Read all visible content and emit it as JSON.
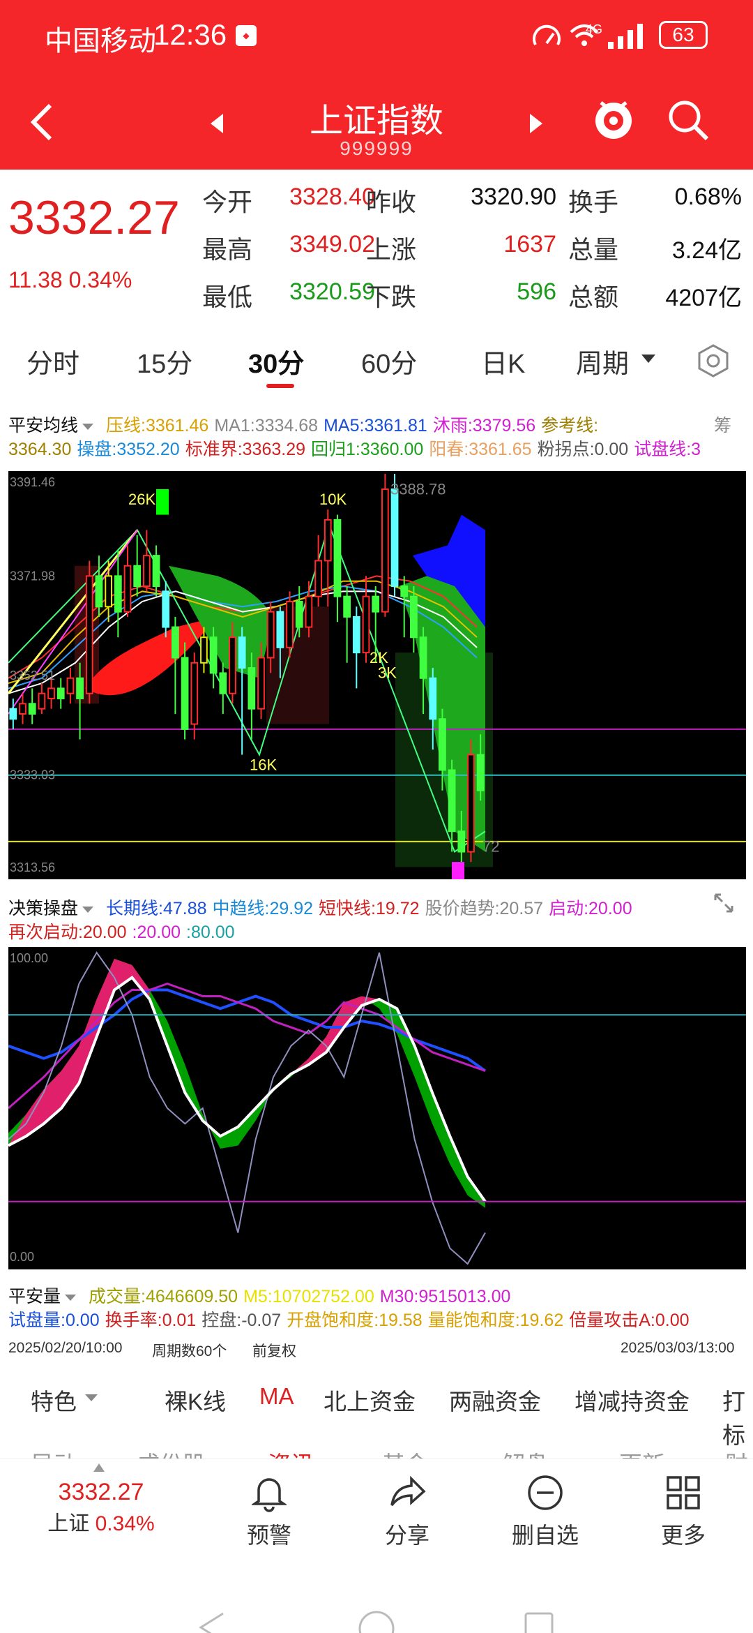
{
  "status": {
    "carrier": "中国移动",
    "time": "12:36",
    "network": "4G",
    "battery": "63"
  },
  "header": {
    "title": "上证指数",
    "code": "999999"
  },
  "quote": {
    "price": "3332.27",
    "change": "11.38",
    "pct": "0.34%",
    "rows": [
      [
        {
          "l": "今开",
          "v": "3328.40",
          "c": "#e02020"
        },
        {
          "l": "昨收",
          "v": "3320.90",
          "c": "#111"
        },
        {
          "l": "换手",
          "v": "0.68%",
          "c": "#111"
        }
      ],
      [
        {
          "l": "最高",
          "v": "3349.02",
          "c": "#e02020"
        },
        {
          "l": "上涨",
          "v": "1637",
          "c": "#e02020"
        },
        {
          "l": "总量",
          "v": "3.24亿",
          "c": "#111"
        }
      ],
      [
        {
          "l": "最低",
          "v": "3320.59",
          "c": "#1a9a1a"
        },
        {
          "l": "下跌",
          "v": "596",
          "c": "#1a9a1a"
        },
        {
          "l": "总额",
          "v": "4207亿",
          "c": "#111"
        }
      ]
    ]
  },
  "tabs": [
    "分时",
    "15分",
    "30分",
    "60分",
    "日K",
    "周期"
  ],
  "ind1": {
    "name": "平安均线",
    "line1": [
      {
        "t": "压线:",
        "v": "3361.46",
        "c": "#d8a000"
      },
      {
        "t": "MA1:",
        "v": "3334.68",
        "c": "#888"
      },
      {
        "t": "MA5:",
        "v": "3361.81",
        "c": "#1a4fd8"
      },
      {
        "t": "沐雨:",
        "v": "3379.56",
        "c": "#d020d0"
      },
      {
        "t": "参考线:",
        "v": "",
        "c": "#a08000"
      }
    ],
    "tail1": "筹",
    "line2": [
      {
        "t": "",
        "v": "3364.30",
        "c": "#a08000"
      },
      {
        "t": "操盘:",
        "v": "3352.20",
        "c": "#1a8ad8"
      },
      {
        "t": "标准界:",
        "v": "3363.29",
        "c": "#d02020"
      },
      {
        "t": "回归1:",
        "v": "3360.00",
        "c": "#1aa01a"
      },
      {
        "t": "阳春:",
        "v": "3361.65",
        "c": "#e8a060"
      },
      {
        "t": "粉拐点:",
        "v": "0.00",
        "c": "#555"
      },
      {
        "t": "试盘线:",
        "v": "3",
        "c": "#d020d0"
      }
    ]
  },
  "chart1": {
    "ticks": [
      "3391.46",
      "3371.98",
      "3352.51",
      "3333.03",
      "3313.56"
    ],
    "labels": [
      "26K",
      "10K",
      "3388.78",
      "2K",
      "3K",
      "16K",
      "72"
    ]
  },
  "ind2": {
    "name": "决策操盘",
    "line1": [
      {
        "t": "长期线:",
        "v": "47.88",
        "c": "#1a4fd8"
      },
      {
        "t": "中趋线:",
        "v": "29.92",
        "c": "#1a8ad8"
      },
      {
        "t": "短快线:",
        "v": "19.72",
        "c": "#d02020"
      },
      {
        "t": "股价趋势:",
        "v": "20.57",
        "c": "#888"
      },
      {
        "t": "启动:",
        "v": "20.00",
        "c": "#d020d0"
      }
    ],
    "line2": [
      {
        "t": "再次启动:",
        "v": "20.00",
        "c": "#d02020"
      },
      {
        "t": ":",
        "v": "20.00",
        "c": "#d020d0"
      },
      {
        "t": ":",
        "v": "80.00",
        "c": "#1aa0a0"
      }
    ]
  },
  "chart2": {
    "ticks": [
      "100.00",
      "0.00"
    ]
  },
  "ind3": {
    "name": "平安量",
    "line1": [
      {
        "t": "成交量:",
        "v": "4646609.50",
        "c": "#a0a000"
      },
      {
        "t": "M5:",
        "v": "10702752.00",
        "c": "#e8e000"
      },
      {
        "t": "M30:",
        "v": "9515013.00",
        "c": "#d020d0"
      }
    ],
    "line2": [
      {
        "t": "试盘量:",
        "v": "0.00",
        "c": "#1a4fd8"
      },
      {
        "t": "换手率:",
        "v": "0.01",
        "c": "#d02020"
      },
      {
        "t": "控盘:",
        "v": "-0.07",
        "c": "#555"
      },
      {
        "t": "开盘饱和度:",
        "v": "19.58",
        "c": "#d8a000"
      },
      {
        "t": "量能饱和度:",
        "v": "19.62",
        "c": "#d8a000"
      },
      {
        "t": "倍量攻击A:",
        "v": "0.00",
        "c": "#d02020"
      }
    ]
  },
  "dates": {
    "start": "2025/02/20/10:00",
    "period": "周期数60个",
    "adj": "前复权",
    "end": "2025/03/03/13:00"
  },
  "subtabs": [
    "特色",
    "裸K线",
    "MA",
    "北上资金",
    "两融资金",
    "增减持资金",
    "打标"
  ],
  "subtabs2": [
    "异动",
    "成份股",
    "资讯",
    "基金",
    "解盘",
    "更新",
    "财"
  ],
  "bottom": {
    "price": "3332.27",
    "name": "上证",
    "pct": "0.34%",
    "items": [
      "预警",
      "分享",
      "删自选",
      "更多"
    ]
  }
}
